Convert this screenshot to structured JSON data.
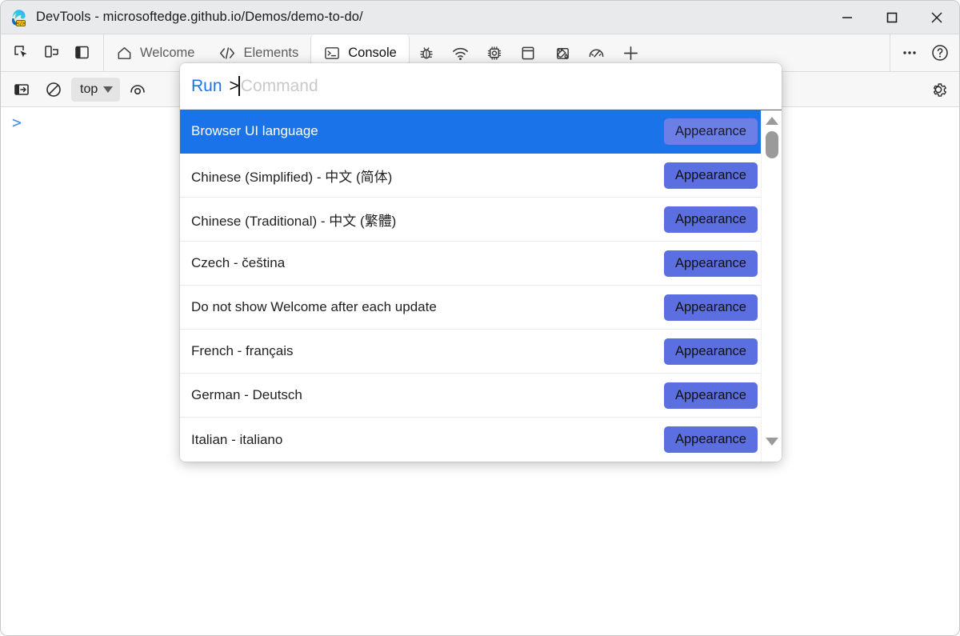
{
  "window": {
    "title": "DevTools - microsoftedge.github.io/Demos/demo-to-do/",
    "logo_icon": "edge-devtools-logo-icon",
    "controls": {
      "minimize_label": "—",
      "minimize_icon": "minimize-icon",
      "maximize_label": "□",
      "maximize_icon": "maximize-icon",
      "close_label": "✕",
      "close_icon": "close-icon"
    }
  },
  "tabstrip": {
    "left_tools": [
      {
        "icon": "inspect-element-icon",
        "name": "inspect-tool-button"
      },
      {
        "icon": "device-emulation-icon",
        "name": "device-emulation-button"
      },
      {
        "icon": "dock-side-icon",
        "name": "dock-side-button"
      }
    ],
    "tabs": [
      {
        "label": "Welcome",
        "icon": "home-icon",
        "active": false
      },
      {
        "label": "Elements",
        "icon": "code-brackets-icon",
        "active": false
      },
      {
        "label": "Console",
        "icon": "console-prompt-icon",
        "active": true
      },
      {
        "label": "",
        "icon": "bug-icon",
        "active": false
      },
      {
        "label": "",
        "icon": "network-wifi-icon",
        "active": false
      },
      {
        "label": "",
        "icon": "memory-chip-icon",
        "active": false
      },
      {
        "label": "",
        "icon": "application-panel-icon",
        "active": false
      },
      {
        "label": "",
        "icon": "paint-bucket-icon",
        "active": false
      },
      {
        "label": "",
        "icon": "performance-gauge-icon",
        "active": false
      },
      {
        "label": "",
        "icon": "plus-icon",
        "active": false
      }
    ],
    "right_tools": [
      {
        "icon": "more-options-icon",
        "name": "more-tools-button"
      },
      {
        "icon": "help-question-icon",
        "name": "help-button"
      }
    ]
  },
  "console_toolbar": {
    "sidebar_toggle_icon": "console-sidebar-icon",
    "clear_icon": "clear-console-icon",
    "context_selector": {
      "value": "top",
      "caret_icon": "chevron-down-icon"
    },
    "live_expression_icon": "eye-live-expression-icon",
    "settings_icon": "gear-icon"
  },
  "console": {
    "prompt_symbol": ">"
  },
  "palette": {
    "prefix_label": "Run",
    "gt_symbol": ">",
    "placeholder": "Command",
    "input_value": "",
    "scrollbar": {
      "up_icon": "scroll-up-arrow-icon",
      "down_icon": "scroll-down-arrow-icon",
      "thumb_name": "scrollbar-thumb"
    },
    "rows": [
      {
        "label": "Browser UI language",
        "badge": "Appearance",
        "selected": true
      },
      {
        "label": "Chinese (Simplified) - 中文 (简体)",
        "badge": "Appearance",
        "selected": false
      },
      {
        "label": "Chinese (Traditional) - 中文 (繁體)",
        "badge": "Appearance",
        "selected": false
      },
      {
        "label": "Czech - čeština",
        "badge": "Appearance",
        "selected": false
      },
      {
        "label": "Do not show Welcome after each update",
        "badge": "Appearance",
        "selected": false
      },
      {
        "label": "French - français",
        "badge": "Appearance",
        "selected": false
      },
      {
        "label": "German - Deutsch",
        "badge": "Appearance",
        "selected": false
      },
      {
        "label": "Italian - italiano",
        "badge": "Appearance",
        "selected": false
      }
    ]
  },
  "colors": {
    "selection_blue": "#1a73e8",
    "badge_purple": "#5b6fe0",
    "accent_link": "#1a73e8",
    "titlebar_bg": "#e9eaec",
    "toolbar_bg": "#f7f7f7"
  }
}
